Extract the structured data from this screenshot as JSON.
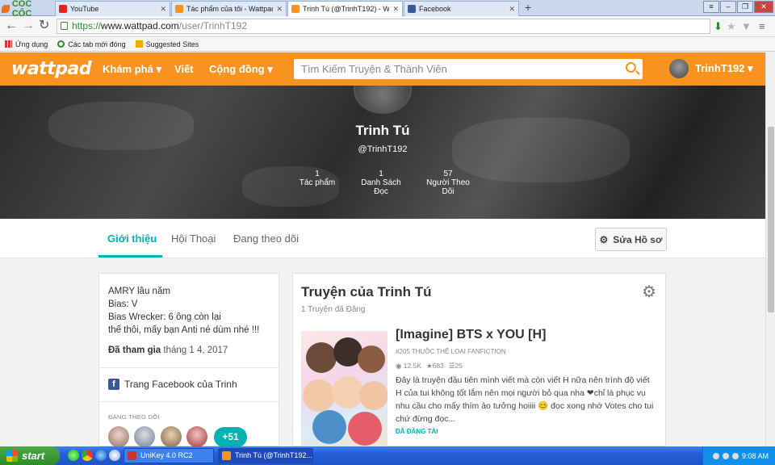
{
  "browser": {
    "logo_text": "CỐC CỐC",
    "tabs": [
      {
        "title": "YouTube",
        "color": "#e62117"
      },
      {
        "title": "Tác phẩm của tôi - Wattpad",
        "color": "#f7931e"
      },
      {
        "title": "Trinh Tú (@TrinhT192) - Watt",
        "color": "#f7931e"
      },
      {
        "title": "Facebook",
        "color": "#3b5998"
      }
    ],
    "url_scheme": "https://",
    "url_host": "www.wattpad.com",
    "url_path": "/user/TrinhT192",
    "bookmarks": [
      "Ứng dụng",
      "Các tab mới đóng",
      "Suggested Sites"
    ]
  },
  "header": {
    "logo": "wattpad",
    "nav_explore": "Khám phá ▾",
    "nav_write": "Viết",
    "nav_community": "Cộng đồng ▾",
    "search_placeholder": "Tìm Kiếm Truyện & Thành Viên",
    "username": "TrinhT192 ▾",
    "accent": "#f7931e"
  },
  "profile": {
    "name": "Trinh Tú",
    "handle": "@TrinhT192",
    "stats": [
      {
        "value": "1",
        "label": "Tác phẩm"
      },
      {
        "value": "1",
        "label": "Danh Sách Đọc"
      },
      {
        "value": "57",
        "label": "Người Theo Dõi"
      }
    ]
  },
  "tabs": {
    "about": "Giới thiệu",
    "conversations": "Hội Thoại",
    "following": "Đang theo dõi",
    "edit_profile": "Sửa Hồ sơ"
  },
  "about": {
    "bio_lines": [
      "AMRY lâu năm",
      "Bias: V",
      "Bias Wrecker: 6 ông còn lại",
      "thế thôi, mấy bạn Anti né dùm nhé !!!"
    ],
    "joined_label": "Đã tham gia",
    "joined_date": "tháng 1 4, 2017",
    "facebook_link": "Trang Facebook của Trinh",
    "following_title": "ĐANG THEO DÕI",
    "following_more": "+51"
  },
  "stories": {
    "title": "Truyện của Trinh Tú",
    "count": "1 Truyện đã Đăng",
    "story": {
      "title": "[Imagine] BTS x YOU [H]",
      "rank": "#205 THUỘC THỂ LOẠI FANFICTION",
      "reads": "12.5K",
      "votes": "683",
      "parts": "25",
      "description": "Đây là truyện đầu tiên mình viết mà còn viết H nữa nên trình độ viết H của tui không tốt lắm nên mọi người bỏ qua nha ❤chỉ là phục vụ nhu cầu cho mấy thím ảo tưởng hoiiii 😊 đọc xong nhớ Votes cho tui chứ đừng đọc...",
      "status": "ĐÃ ĐĂNG TẢI"
    }
  },
  "taskbar": {
    "start": "start",
    "tasks": [
      "UniKey 4.0 RC2",
      "Trinh Tú (@TrinhT192..."
    ],
    "time": "9:08 AM"
  }
}
